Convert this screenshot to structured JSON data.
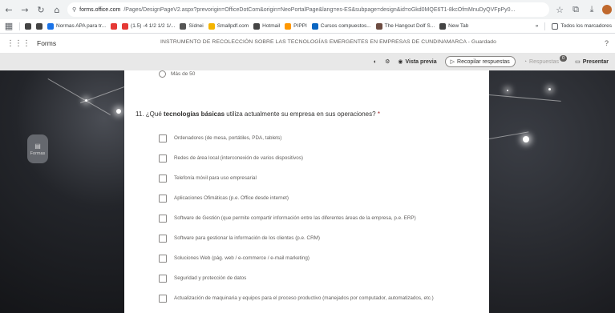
{
  "browser": {
    "url_host": "forms.office.com",
    "url_rest": "/Pages/DesignPageV2.aspx?prevorigin=OfficeDotCom&origin=NeoPortalPage&lang=es-ES&subpage=design&id=oGkd0MQE6T1-8kcOfmMnuDyQVFpPy0...",
    "bookmarks": [
      "Normas APA para tr...",
      "(1.5) -4 1/2 1/2 1/...",
      "Sídnei",
      "Smallpdf.com",
      "Hotmail",
      "PIPPI",
      "Cursos compuestos...",
      "The Hangout Dolf S...",
      "New Tab"
    ],
    "bookmarks_right": "Todos los marcadores"
  },
  "app": {
    "name": "Forms",
    "doc_title": "INSTRUMENTO DE RECOLECCIÓN SOBRE LAS TECNOLOGÍAS EMERGENTES EN EMPRESAS DE CUNDINAMARCA  -  Guardado",
    "help": "?"
  },
  "toolbar": {
    "preview": "Vista previa",
    "collect": "Recopilar respuestas",
    "responses": "Respuestas",
    "responses_count": "0",
    "present": "Presentar"
  },
  "side_widget": {
    "label": "Formas"
  },
  "form": {
    "prev_option": "Más de 50",
    "question_number": "11.",
    "question_pre": "¿Qué ",
    "question_bold": "tecnologías básicas",
    "question_post": " utiliza actualmente su empresa en sus operaciones?",
    "required_mark": "*",
    "options": [
      "Ordenadores (de mesa, portátiles, PDA, tablets)",
      "Redes de área local (interconexión de varios dispositivos)",
      "Telefonía móvil para uso empresarial",
      "Aplicaciones Ofimáticas (p.e. Office desde internet)",
      "Software de Gestión (que permite compartir información entre las diferentes áreas de la empresa, p.e. ERP)",
      "Software para gestionar la información de los clientes (p.e. CRM)",
      "Soluciones Web (pág. web / e-commerce / e-mail marketing)",
      "Seguridad y protección de datos",
      "Actualización de maquinaria y equipos para el proceso productivo (manejados por computador, automatizados, etc.)"
    ]
  }
}
